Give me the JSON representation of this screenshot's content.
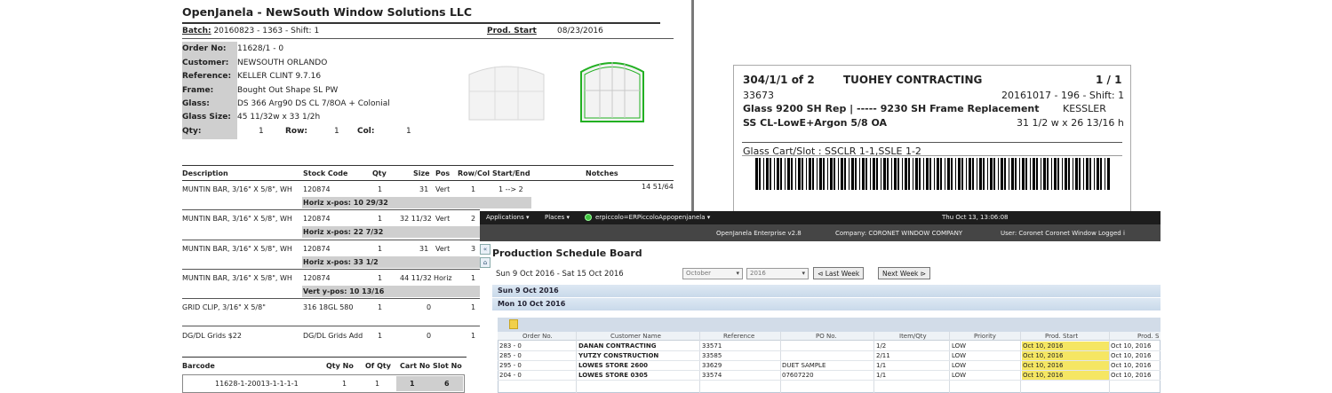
{
  "work_order": {
    "title": "OpenJanela - NewSouth Window Solutions LLC",
    "batch_label": "Batch:",
    "batch_value": "20160823 - 1363 - Shift: 1",
    "prod_start_label": "Prod. Start",
    "prod_start_value": "08/23/2016",
    "fields": [
      {
        "label": "Order No:",
        "value": "11628/1 - 0"
      },
      {
        "label": "Customer:",
        "value": "NEWSOUTH ORLANDO"
      },
      {
        "label": "Reference:",
        "value": "KELLER CLINT  9.7.16"
      },
      {
        "label": "Frame:",
        "value": "Bought Out Shape SL PW"
      },
      {
        "label": "Glass:",
        "value": "DS 366 Arg90 DS CL  7/8OA + Colonial"
      },
      {
        "label": "Glass Size:",
        "value": "45 11/32w x 33 1/2h"
      }
    ],
    "qty_label": "Qty:",
    "qty_value": "1",
    "row_label": "Row:",
    "row_value": "1",
    "col_label": "Col:",
    "col_value": "1",
    "table_headers": [
      "Description",
      "Stock Code",
      "Qty",
      "Size",
      "Pos",
      "Row/Col",
      "Start/End",
      "Notches"
    ],
    "rows": [
      {
        "desc": "MUNTIN BAR, 3/16\" X 5/8\", WH",
        "code": "120874",
        "qty": "1",
        "size": "31",
        "pos": "Vert",
        "rowcol": "1",
        "startend": "1 --> 2",
        "notches": "14 51/64",
        "sub": "Horiz x-pos: 10 29/32"
      },
      {
        "desc": "MUNTIN BAR, 3/16\" X 5/8\", WH",
        "code": "120874",
        "qty": "1",
        "size": "32 11/32",
        "pos": "Vert",
        "rowcol": "2",
        "startend": "",
        "notches": "",
        "sub": "Horiz x-pos: 22 7/32"
      },
      {
        "desc": "MUNTIN BAR, 3/16\" X 5/8\", WH",
        "code": "120874",
        "qty": "1",
        "size": "31",
        "pos": "Vert",
        "rowcol": "3",
        "startend": "",
        "notches": "",
        "sub": "Horiz x-pos: 33 1/2"
      },
      {
        "desc": "MUNTIN BAR, 3/16\" X 5/8\", WH",
        "code": "120874",
        "qty": "1",
        "size": "44 11/32",
        "pos": "Horiz",
        "rowcol": "1",
        "startend": "",
        "notches": "",
        "sub": "Vert y-pos: 10 13/16"
      },
      {
        "desc": "GRID CLIP, 3/16\" X 5/8\"",
        "code": "316 18GL 580",
        "qty": "1",
        "size": "0",
        "pos": "",
        "rowcol": "1",
        "startend": "",
        "notches": "",
        "sub": ""
      },
      {
        "desc": "DG/DL Grids $22",
        "code": "DG/DL Grids Add",
        "qty": "1",
        "size": "0",
        "pos": "",
        "rowcol": "1",
        "startend": "",
        "notches": "",
        "sub": ""
      }
    ],
    "barcode_headers": [
      "Barcode",
      "Qty No",
      "Of Qty",
      "Cart No",
      "Slot No"
    ],
    "barcode_row": [
      "11628-1-20013-1-1-1-1",
      "1",
      "1",
      "1",
      "6"
    ]
  },
  "label": {
    "line1_left": "304/1/1 of 2",
    "line1_mid": "TUOHEY CONTRACTING",
    "line1_right": "1 / 1",
    "line2_left": "33673",
    "line2_right": "20161017 - 196 - Shift: 1",
    "line3_left": "Glass 9200 SH Rep | ----- 9230 SH Frame Replacement",
    "line3_right": "KESSLER",
    "line4_left": "SS CL-LowE+Argon 5/8 OA",
    "line4_right": "31 1/2 w x 26 13/16 h",
    "cart_slot": "Glass Cart/Slot : SSCLR 1-1,SSLE 1-2"
  },
  "schedule": {
    "menu_applications": "Applications ▾",
    "menu_places": "Places ▾",
    "menu_user": "erpiccolo=ERPiccoloAppopenjanela ▾",
    "clock": "Thu Oct 13, 13:06:08",
    "app_version": "OpenJanela Enterprise v2.8",
    "company": "Company: CORONET WINDOW COMPANY",
    "user": "User: Coronet Coronet Window  Logged i",
    "title": "Production Schedule Board",
    "date_range": "Sun 9 Oct 2016 - Sat 15 Oct 2016",
    "month_select": "October",
    "year_select": "2016",
    "last_week": "Last Week",
    "next_week": "Next Week",
    "day1": "Sun 9 Oct 2016",
    "day2": "Mon 10 Oct 2016",
    "columns": [
      "Order No.",
      "Customer Name",
      "Reference",
      "PO No.",
      "Item/Qty",
      "Priority",
      "Prod. Start",
      "Prod. S"
    ],
    "rows": [
      [
        "283 - 0",
        "DANAN CONTRACTING",
        "33571",
        "",
        "1/2",
        "LOW",
        "Oct 10, 2016",
        "Oct 10, 2016"
      ],
      [
        "285 - 0",
        "YUTZY CONSTRUCTION",
        "33585",
        "",
        "2/11",
        "LOW",
        "Oct 10, 2016",
        "Oct 10, 2016"
      ],
      [
        "295 - 0",
        "LOWES STORE 2600",
        "33629",
        "DUET SAMPLE",
        "1/1",
        "LOW",
        "Oct 10, 2016",
        "Oct 10, 2016"
      ],
      [
        "204 - 0",
        "LOWES STORE 0305",
        "33574",
        "07607220",
        "1/1",
        "LOW",
        "Oct 10, 2016",
        "Oct 10, 2016"
      ]
    ],
    "highlight_color": "#f5e663"
  }
}
